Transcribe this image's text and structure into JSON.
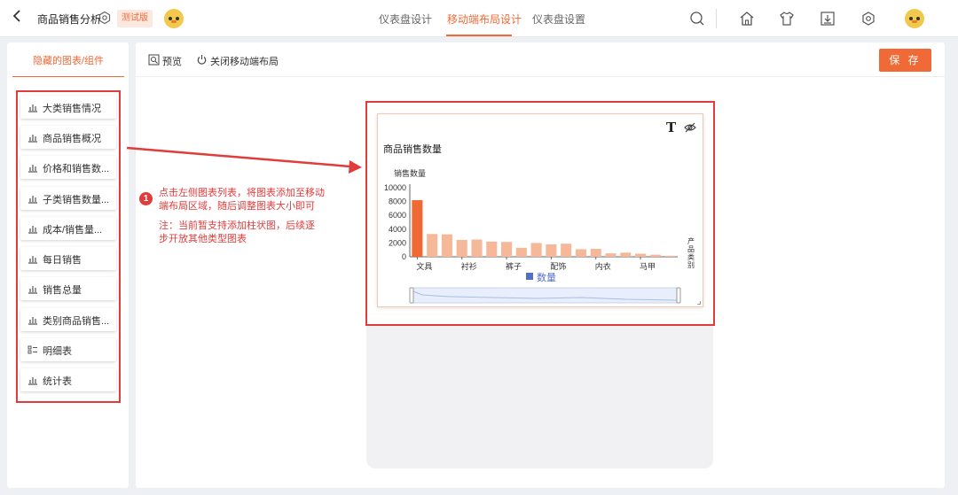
{
  "header": {
    "title": "商品销售分析",
    "badge": "测试版",
    "tabs": [
      {
        "label": "仪表盘设计",
        "active": false
      },
      {
        "label": "移动端布局设计",
        "active": true
      },
      {
        "label": "仪表盘设置",
        "active": false
      }
    ],
    "icons": [
      "search-icon",
      "home-icon",
      "shirt-icon",
      "download-icon",
      "settings-icon",
      "avatar"
    ]
  },
  "sidebar": {
    "title": "隐藏的图表/组件",
    "items": [
      {
        "label": "大类销售情况",
        "icon": "bar-chart-icon"
      },
      {
        "label": "商品销售概况",
        "icon": "bar-chart-icon"
      },
      {
        "label": "价格和销售数...",
        "icon": "bar-chart-icon"
      },
      {
        "label": "子类销售数量...",
        "icon": "bar-chart-icon"
      },
      {
        "label": "成本/销售量...",
        "icon": "bar-chart-icon"
      },
      {
        "label": "每日销售",
        "icon": "bar-chart-icon"
      },
      {
        "label": "销售总量",
        "icon": "bar-chart-icon"
      },
      {
        "label": "类别商品销售...",
        "icon": "bar-chart-icon"
      },
      {
        "label": "明细表",
        "icon": "detail-table-icon"
      },
      {
        "label": "统计表",
        "icon": "bar-chart-icon"
      }
    ]
  },
  "toolbar": {
    "preview_label": "预览",
    "close_mobile_label": "关闭移动端布局",
    "save_label": "保 存"
  },
  "annotation": {
    "number": "1",
    "line1": "点击左侧图表列表，将图表添加至移动",
    "line2": "端布局区域，随后调整图表大小即可",
    "note1": "注：当前暂支持添加柱状图，后续逐",
    "note2": "步开放其他类型图表"
  },
  "colors": {
    "accent": "#ef6a36",
    "bar_highlight": "#ee6a35",
    "bar": "#f5b898",
    "annotation_red": "#e23b3b",
    "legend": "#5470c6"
  },
  "chart_data": {
    "type": "bar",
    "title": "商品销售数量",
    "ylabel": "销售数量",
    "xlabel": "产品类别",
    "ylim": [
      0,
      10000
    ],
    "yticks": [
      0,
      2000,
      4000,
      6000,
      8000,
      10000
    ],
    "xtick_labels": [
      "文具",
      "衬衫",
      "裤子",
      "配饰",
      "内衣",
      "马甲"
    ],
    "xtick_indices": [
      0,
      3,
      6,
      9,
      12,
      15
    ],
    "legend": "数量",
    "categories": [
      "文具",
      "",
      "",
      "衬衫",
      "",
      "",
      "裤子",
      "",
      "",
      "配饰",
      "",
      "",
      "内衣",
      "",
      "",
      "马甲",
      "",
      ""
    ],
    "values": [
      8200,
      3300,
      3250,
      2450,
      2500,
      2200,
      2150,
      1300,
      2000,
      1800,
      1900,
      1100,
      1150,
      500,
      600,
      450,
      300,
      150
    ]
  }
}
